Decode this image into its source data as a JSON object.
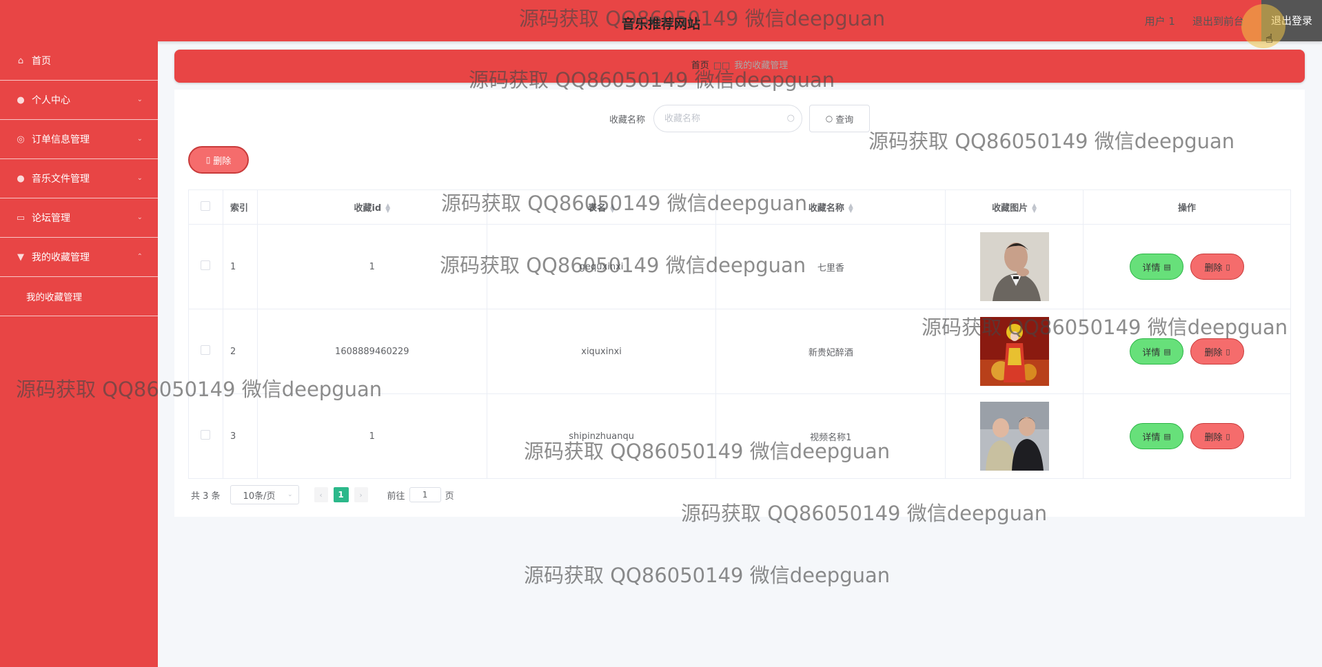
{
  "header": {
    "title": "音乐推荐网站",
    "user": "用户 1",
    "back_front": "退出到前台",
    "logout": "退出登录"
  },
  "sidebar": {
    "items": [
      {
        "label": "首页",
        "icon": "home-icon"
      },
      {
        "label": "个人中心",
        "icon": "user-icon"
      },
      {
        "label": "订单信息管理",
        "icon": "compass-icon"
      },
      {
        "label": "音乐文件管理",
        "icon": "user-icon"
      },
      {
        "label": "论坛管理",
        "icon": "chat-icon"
      },
      {
        "label": "我的收藏管理",
        "icon": "trophy-icon"
      }
    ],
    "subitem": "我的收藏管理"
  },
  "breadcrumb": {
    "home": "首页",
    "separator": "□□",
    "current": "我的收藏管理"
  },
  "search": {
    "label": "收藏名称",
    "placeholder": "收藏名称",
    "button": "查询"
  },
  "toolbar": {
    "delete": "删除"
  },
  "table": {
    "headers": {
      "index": "索引",
      "id": "收藏id",
      "table": "表名",
      "name": "收藏名称",
      "image": "收藏图片",
      "ops": "操作"
    },
    "rows": [
      {
        "index": "1",
        "id": "1",
        "table": "gequxinxi",
        "name": "七里香"
      },
      {
        "index": "2",
        "id": "1608889460229",
        "table": "xiquxinxi",
        "name": "新贵妃醉酒"
      },
      {
        "index": "3",
        "id": "1",
        "table": "shipinzhuanqu",
        "name": "视频名称1"
      }
    ],
    "detail_label": "详情",
    "delete_label": "删除"
  },
  "pagination": {
    "total": "共 3 条",
    "page_size": "10条/页",
    "current_page": "1",
    "goto": "前往",
    "goto_value": "1",
    "page_suffix": "页"
  },
  "watermark": "源码获取 QQ86050149 微信deepguan",
  "colors": {
    "accent": "#e84545",
    "success": "#67e07a",
    "danger": "#f56c6c",
    "page_active": "#2bb88a"
  }
}
